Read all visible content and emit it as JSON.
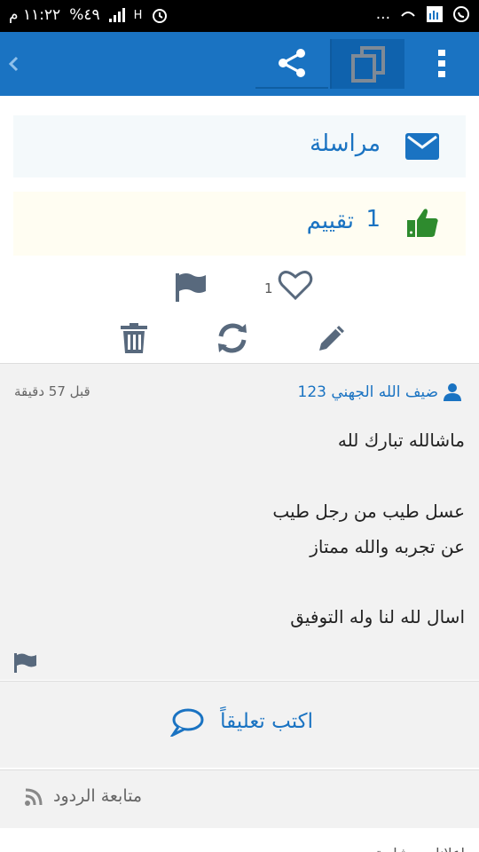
{
  "status_bar": {
    "time": "١١:٢٢ م",
    "battery": "%٤٩",
    "network": "H",
    "more": "..."
  },
  "app_bar": {
    "share_icon": "share-icon",
    "copy_icon": "copy-icon",
    "more_icon": "more-vert-icon",
    "back_icon": "chevron-left-icon"
  },
  "message": {
    "label": "مراسلة",
    "icon": "envelope-icon"
  },
  "rating": {
    "count": "1",
    "label": "تقييم",
    "icon": "thumbs-up-icon"
  },
  "actions": {
    "like_count": "1"
  },
  "comment": {
    "author": "ضيف الله الجهني 123",
    "time": "قبل 57 دقيقة",
    "lines": [
      "ماشالله تبارك لله",
      "عسل طيب من رجل طيب",
      "عن تجربه والله ممتاز",
      "اسال لله لنا وله التوفيق"
    ]
  },
  "write_comment": {
    "label": "اكتب تعليقاً"
  },
  "follow": {
    "label": "متابعة الردود"
  },
  "bottom": {
    "peek": "إعلانات مشابهة"
  },
  "colors": {
    "primary": "#1a73c2",
    "like_green": "#2e8b2e",
    "icon_gray": "#58697d"
  }
}
